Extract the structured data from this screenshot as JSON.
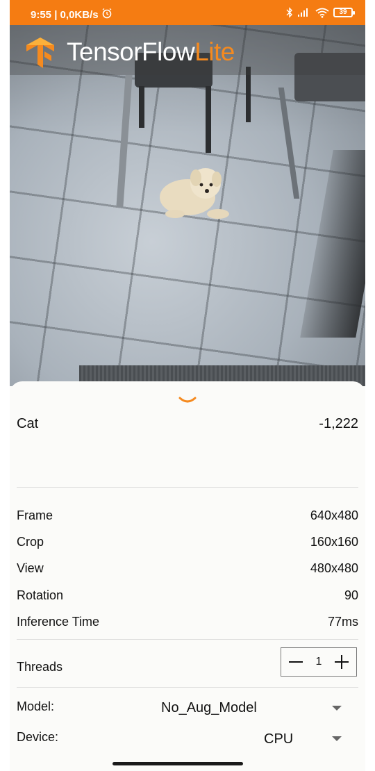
{
  "status_bar": {
    "time_speed": "9:55 | 0,0KB/s",
    "battery": "39"
  },
  "app": {
    "logo_word1": "TensorFlow",
    "logo_word2": "Lite",
    "brand_color": "#f58a1f",
    "statusbar_color": "#f57c12"
  },
  "result": {
    "label": "Cat",
    "score": "-1,222"
  },
  "info": {
    "frame_label": "Frame",
    "frame_value": "640x480",
    "crop_label": "Crop",
    "crop_value": "160x160",
    "view_label": "View",
    "view_value": "480x480",
    "rotation_label": "Rotation",
    "rotation_value": "90",
    "inference_label": "Inference Time",
    "inference_value": "77ms"
  },
  "threads": {
    "label": "Threads",
    "value": "1"
  },
  "model": {
    "label": "Model:",
    "selected": "No_Aug_Model"
  },
  "device": {
    "label": "Device:",
    "selected": "CPU"
  }
}
